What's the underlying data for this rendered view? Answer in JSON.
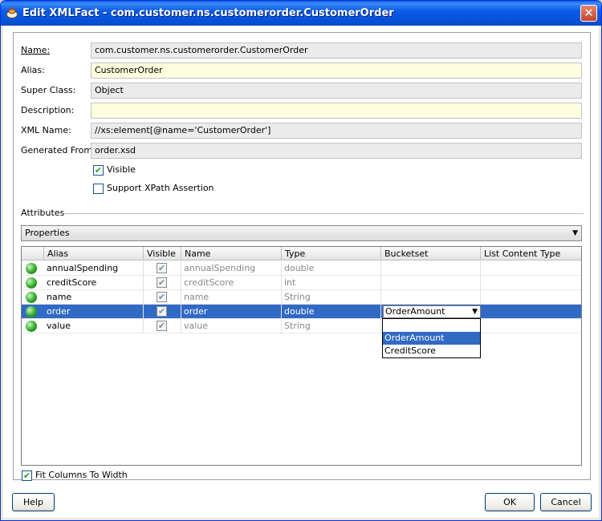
{
  "window": {
    "title": "Edit XMLFact - com.customer.ns.customerorder.CustomerOrder",
    "close_glyph": "✕"
  },
  "form": {
    "name_label": "Name:",
    "name_value": "com.customer.ns.customerorder.CustomerOrder",
    "alias_label": "Alias:",
    "alias_value": "CustomerOrder",
    "superclass_label": "Super Class:",
    "superclass_value": "Object",
    "description_label": "Description:",
    "description_value": "",
    "xmlname_label": "XML Name:",
    "xmlname_value": "//xs:element[@name='CustomerOrder']",
    "generated_label": "Generated From:",
    "generated_value": "order.xsd",
    "visible_label": "Visible",
    "visible_checked": true,
    "xpath_label": "Support XPath Assertion",
    "xpath_checked": false
  },
  "attributes": {
    "section_title": "Attributes",
    "view_select": "Properties",
    "columns": [
      "Alias",
      "Visible",
      "Name",
      "Type",
      "Bucketset",
      "List Content Type"
    ],
    "rows": [
      {
        "alias": "annualSpending",
        "visible": true,
        "name": "annualSpending",
        "type": "double",
        "bucketset": "",
        "list_type": ""
      },
      {
        "alias": "creditScore",
        "visible": true,
        "name": "creditScore",
        "type": "int",
        "bucketset": "",
        "list_type": ""
      },
      {
        "alias": "name",
        "visible": true,
        "name": "name",
        "type": "String",
        "bucketset": "",
        "list_type": ""
      },
      {
        "alias": "order",
        "visible": true,
        "name": "order",
        "type": "double",
        "bucketset": "OrderAmount",
        "list_type": ""
      },
      {
        "alias": "value",
        "visible": true,
        "name": "value",
        "type": "String",
        "bucketset": "",
        "list_type": ""
      }
    ],
    "selected_row": 3,
    "bucket_options": [
      "",
      "OrderAmount",
      "CreditScore"
    ],
    "bucket_selected": "OrderAmount",
    "fit_label": "Fit Columns To Width",
    "fit_checked": true
  },
  "buttons": {
    "help": "Help",
    "ok": "OK",
    "cancel": "Cancel"
  },
  "colors": {
    "title_bar": "#0a5ce8",
    "selection": "#316ac5",
    "editable_field": "#ffffe0",
    "readonly_field": "#ebebeb",
    "status_dot": "#2ea626"
  },
  "icons": {
    "title": "oracle-rules-icon",
    "row_status": "green-dot-icon",
    "check": "checkmark-icon",
    "dropdown": "triangle-down-icon"
  }
}
